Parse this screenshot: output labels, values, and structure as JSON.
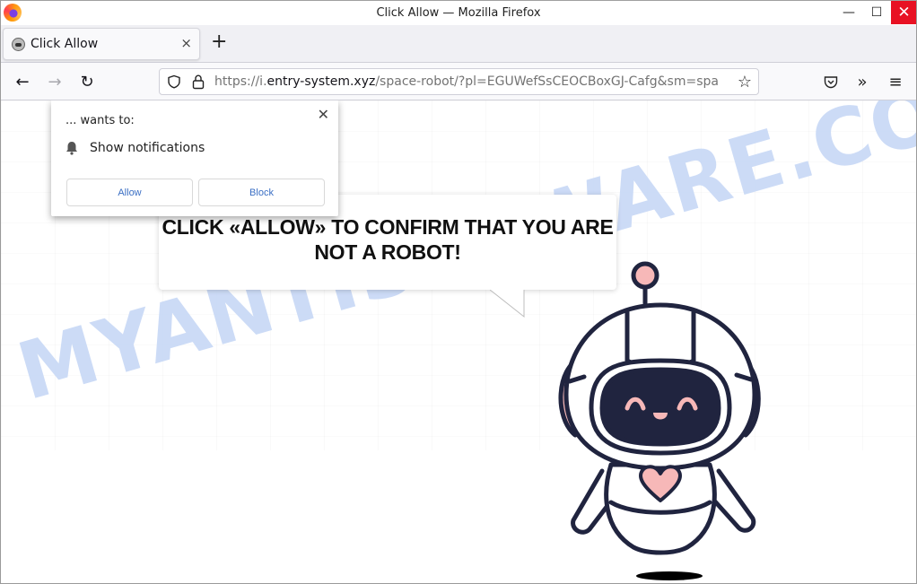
{
  "window": {
    "title": "Click Allow — Mozilla Firefox",
    "controls": {
      "minimize": "—",
      "maximize": "☐",
      "close": "✕"
    },
    "accent_close": "#e81123"
  },
  "tabs": [
    {
      "label": "Click Allow",
      "active": true,
      "close": "×"
    }
  ],
  "new_tab": "+",
  "nav": {
    "back": "←",
    "forward": "→",
    "reload": "↻",
    "url_scheme": "https://i.",
    "url_host": "entry-system.xyz",
    "url_path": "/space-robot/?pl=EGUWefSsCEOCBoxGJ-Cafg&sm=spa",
    "bookmark_star": "☆",
    "pocket": "⛉",
    "overflow": "»",
    "menu": "≡"
  },
  "permission_popup": {
    "wants_to": "... wants to:",
    "close": "✕",
    "permission": "Show notifications",
    "allow_label": "Allow",
    "block_label": "Block"
  },
  "page": {
    "headline": "CLICK «ALLOW» TO CONFIRM THAT YOU ARE NOT A ROBOT!",
    "watermark": "MYANTISPYWARE.COM",
    "colors": {
      "robot_outline": "#20243f",
      "robot_pink": "#f7b8b8",
      "watermark": "#c7d8f6",
      "button_text": "#3b6fc4"
    }
  }
}
